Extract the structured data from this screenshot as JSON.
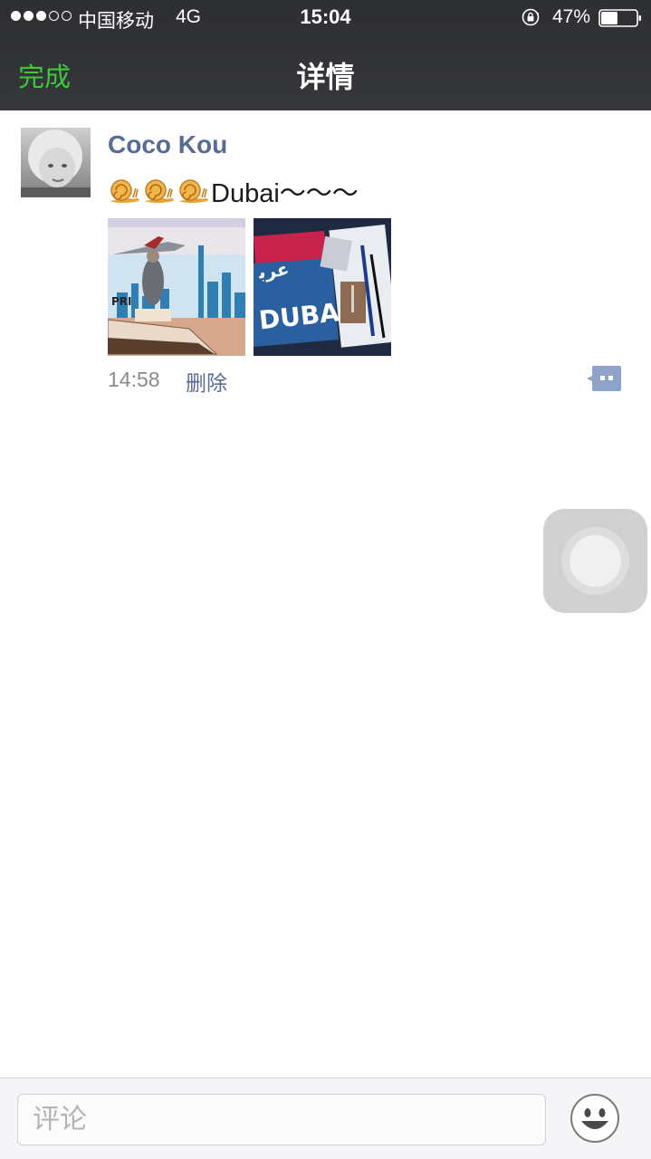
{
  "status_bar": {
    "carrier": "中国移动",
    "network": "4G",
    "time": "15:04",
    "battery_percent": "47%",
    "battery_level": 0.47,
    "signal_bars": 3,
    "signal_max": 5
  },
  "nav": {
    "done_label": "完成",
    "title": "详情"
  },
  "post": {
    "username": "Coco Kou",
    "text": "Dubai～～～",
    "emoji_prefix_count": 3,
    "time": "14:58",
    "delete_label": "删除"
  },
  "comment_bar": {
    "placeholder": "评论"
  },
  "colors": {
    "header_bg": "#2e2f33",
    "done_green": "#3fc83b",
    "link_blue": "#576b95",
    "timestamp_gray": "#8a8a8a"
  },
  "icons": {
    "status_lock": "rotation-lock-icon",
    "battery": "battery-icon",
    "comment": "comment-bubble-icon",
    "emoji": "smiley-face-icon",
    "assistive": "assistive-touch-icon"
  }
}
